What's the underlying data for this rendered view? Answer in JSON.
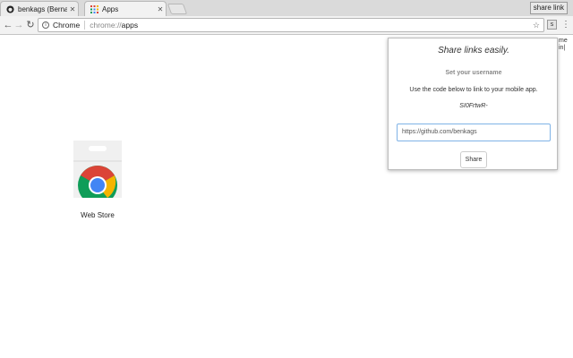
{
  "tabs": [
    {
      "title": "benkags (Bernard K",
      "close": "✕",
      "favicon": "github-icon"
    },
    {
      "title": "Apps",
      "close": "✕",
      "favicon": "apps-grid-icon"
    }
  ],
  "profile": {
    "label": "share link"
  },
  "toolbar": {
    "back": "←",
    "forward": "→",
    "reload": "↻",
    "scheme_label": "Chrome",
    "url_prefix": "chrome://",
    "url_host": "apps",
    "star": "☆",
    "extension_label": "s",
    "menu": "⋮"
  },
  "edge_text": {
    "line1": "me",
    "line2": "in|"
  },
  "apps": [
    {
      "label": "Web Store",
      "icon": "chrome-web-store-icon"
    }
  ],
  "popup": {
    "heading": "Share links easily.",
    "subheading": "Set your username",
    "description": "Use the code below to link to your mobile app.",
    "code": "SI0FrtwR-",
    "input_value": "https://github.com/benkags",
    "share_label": "Share"
  },
  "colors": {
    "input_border": "#7fb3e6",
    "chrome_red": "#db4437",
    "chrome_green": "#0f9d58",
    "chrome_yellow": "#f4b400",
    "chrome_blue": "#4285f4"
  }
}
